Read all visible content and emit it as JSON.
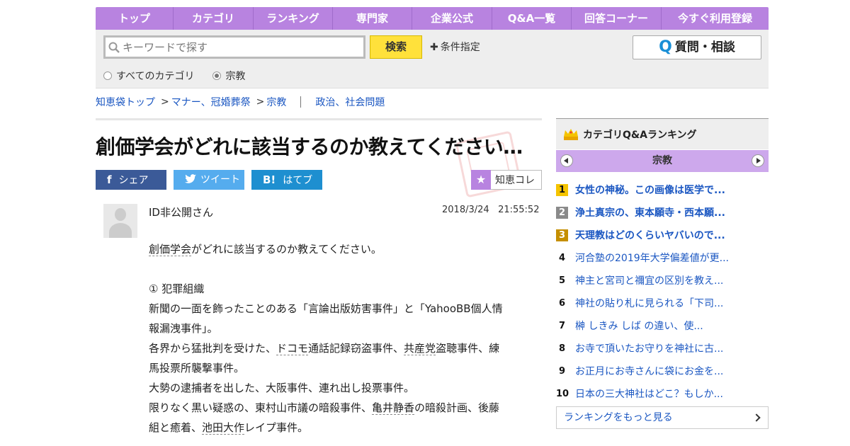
{
  "nav": {
    "items": [
      "トップ",
      "カテゴリ",
      "ランキング",
      "専門家",
      "企業公式",
      "Q&A一覧",
      "回答コーナー",
      "今すぐ利用登録"
    ]
  },
  "search": {
    "placeholder": "キーワードで探す",
    "button": "検索",
    "conditions": "条件指定",
    "ask_button": "質問・相談",
    "ask_icon": "Q",
    "scope_all": "すべてのカテゴリ",
    "scope_current": "宗教"
  },
  "breadcrumb": {
    "items": [
      "知恵袋トップ",
      "マナー、冠婚葬祭",
      "宗教"
    ],
    "related": "政治、社会問題"
  },
  "question": {
    "title": "創価学会がどれに該当するのか教えてください…",
    "share": {
      "facebook": "シェア",
      "twitter": "ツイート",
      "hatena": "はてブ",
      "hatena_icon": "B!",
      "facebook_icon": "f"
    },
    "collection": "知恵コレ",
    "user": "ID非公開さん",
    "date": "2018/3/24",
    "time": "21:55:52",
    "body": [
      [
        "",
        "創価学会",
        "がどれに該当するのか教えてください。"
      ],
      [
        "",
        "",
        ""
      ],
      [
        "① 犯罪組織",
        "",
        ""
      ],
      [
        "新聞の一面を飾ったことのある「言論出版妨害事件」と「YahooBB個人情",
        "",
        ""
      ],
      [
        "報漏洩事件」。",
        "",
        ""
      ],
      [
        "各界から猛批判を受けた、",
        "ドコモ",
        "通話記録窃盗事件、"
      ],
      [
        "馬投票所襲撃事件。",
        "",
        ""
      ],
      [
        "大勢の逮捕者を出した、大阪事件、連れ出し投票事件。",
        "",
        ""
      ],
      [
        "限りなく黒い疑惑の、東村山市議の暗殺事件、",
        "亀井静香",
        "の暗殺計画、後藤"
      ],
      [
        "組と癒着、",
        "池田大作",
        "レイプ事件。"
      ]
    ],
    "body_line6_extra": {
      "before": "",
      "linked": "共産党",
      "after": "盗聴事件、練"
    }
  },
  "sidebar": {
    "title": "カテゴリQ&Aランキング",
    "category": "宗教",
    "ranking": [
      {
        "rank": "1",
        "title": "女性の神秘。この画像は医学で..."
      },
      {
        "rank": "2",
        "title": "浄土真宗の、東本願寺・西本願..."
      },
      {
        "rank": "3",
        "title": "天理教はどのくらいヤバいので..."
      },
      {
        "rank": "4",
        "title": "河合塾の2019年大学偏差値が更..."
      },
      {
        "rank": "5",
        "title": "神主と宮司と禰宜の区別を教え..."
      },
      {
        "rank": "6",
        "title": "神社の貼り札に見られる「下司..."
      },
      {
        "rank": "7",
        "title": "榊 しきみ しば の違い、使..."
      },
      {
        "rank": "8",
        "title": "お寺で頂いたお守りを神社に古..."
      },
      {
        "rank": "9",
        "title": "お正月にお寺さんに袋にお金を..."
      },
      {
        "rank": "10",
        "title": "日本の三大神社はどこ？もしか..."
      }
    ],
    "more": "ランキングをもっと見る"
  },
  "colors": {
    "accent": "#b883e0",
    "link": "#1b57c2",
    "search_button": "#ffe13b"
  }
}
